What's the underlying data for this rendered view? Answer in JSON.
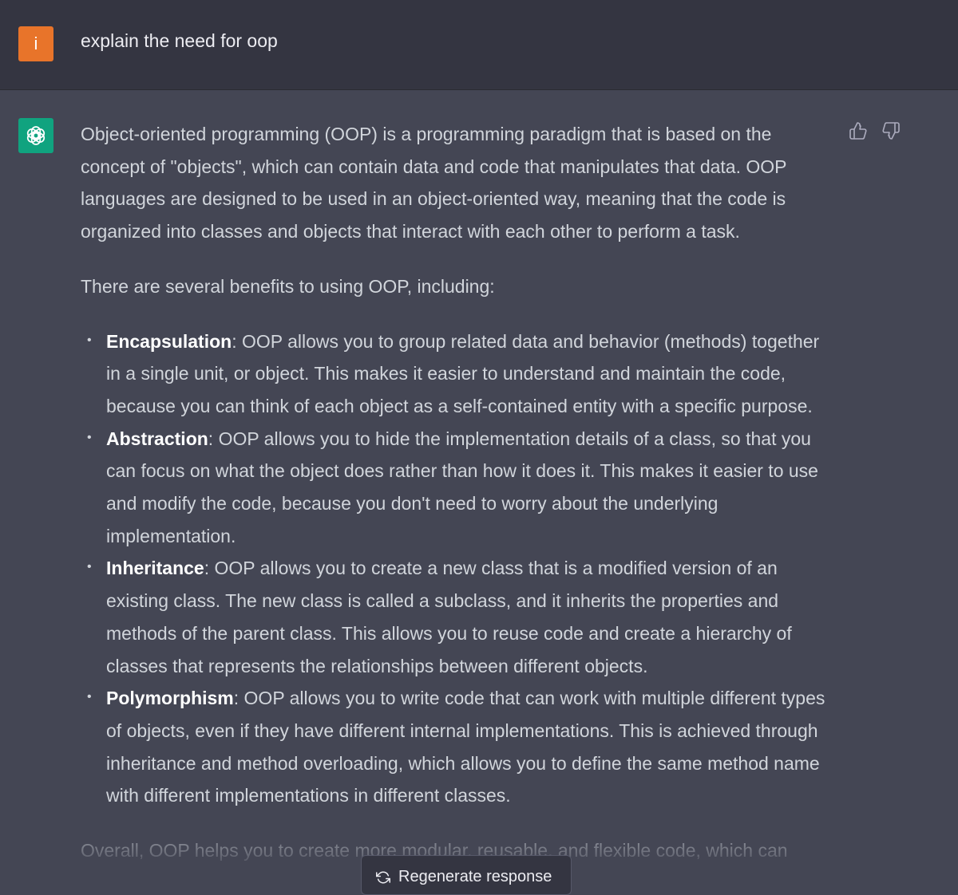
{
  "user": {
    "avatar_letter": "i",
    "message": "explain the need for oop"
  },
  "assistant": {
    "icons": {
      "avatar": "openai-logo-icon",
      "thumbs_up": "thumbs-up-icon",
      "thumbs_down": "thumbs-down-icon"
    },
    "intro": "Object-oriented programming (OOP) is a programming paradigm that is based on the concept of \"objects\", which can contain data and code that manipulates that data. OOP languages are designed to be used in an object-oriented way, meaning that the code is organized into classes and objects that interact with each other to perform a task.",
    "lead": "There are several benefits to using OOP, including:",
    "bullets": [
      {
        "term": "Encapsulation",
        "text": ": OOP allows you to group related data and behavior (methods) together in a single unit, or object. This makes it easier to understand and maintain the code, because you can think of each object as a self-contained entity with a specific purpose."
      },
      {
        "term": "Abstraction",
        "text": ": OOP allows you to hide the implementation details of a class, so that you can focus on what the object does rather than how it does it. This makes it easier to use and modify the code, because you don't need to worry about the underlying implementation."
      },
      {
        "term": "Inheritance",
        "text": ": OOP allows you to create a new class that is a modified version of an existing class. The new class is called a subclass, and it inherits the properties and methods of the parent class. This allows you to reuse code and create a hierarchy of classes that represents the relationships between different objects."
      },
      {
        "term": "Polymorphism",
        "text": ": OOP allows you to write code that can work with multiple different types of objects, even if they have different internal implementations. This is achieved through inheritance and method overloading, which allows you to define the same method name with different implementations in different classes."
      }
    ],
    "overall": "Overall, OOP helps you to create more modular, reusable, and flexible code, which can"
  },
  "regenerate": {
    "label": "Regenerate response",
    "icon": "refresh-icon"
  },
  "colors": {
    "user_bg": "#343541",
    "assistant_bg": "#444654",
    "user_avatar": "#e8742a",
    "bot_avatar": "#10a37f"
  }
}
